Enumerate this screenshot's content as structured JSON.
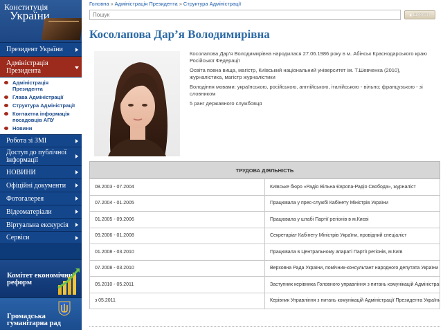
{
  "logo": {
    "line1": "Конституція",
    "line2": "України"
  },
  "nav": [
    {
      "label": "Президент України",
      "active": false
    },
    {
      "label": "Адміністрація Президента",
      "active": true
    },
    {
      "label": "Робота зі ЗМІ",
      "active": false
    },
    {
      "label": "Доступ до публічної інформації",
      "active": false
    },
    {
      "label": "НОВИНИ",
      "active": false
    },
    {
      "label": "Офіційні документи",
      "active": false
    },
    {
      "label": "Фотогалерея",
      "active": false
    },
    {
      "label": "Відеоматеріали",
      "active": false
    },
    {
      "label": "Віртуальна екскурсія",
      "active": false
    },
    {
      "label": "Сервіси",
      "active": false
    }
  ],
  "subnav": [
    "Адміністрація Президента",
    "Глава Адміністрації",
    "Структура Адміністрації",
    "Контактна інформація посадовців АПУ",
    "Новини"
  ],
  "banners": {
    "banner1": "Комітет економічних реформ",
    "banner2": "Громадська гуманітарна рад"
  },
  "breadcrumb": [
    "Головна",
    "Адміністрація Президента",
    "Структура Адміністрації"
  ],
  "search": {
    "placeholder": "Пошук",
    "button_label": "Шукати"
  },
  "page_title": "Косолапова Дар’я Володимирівна",
  "bio": [
    "Косолапова Дар’я Володимирівна народилася 27.06.1986 року в м. Абінськ Краснодарського краю Російської Федерації",
    "Освіта повна вища, магістр, Київський національний університет ім. Т.Шевченка (2010), журналістика, магістр журналістики",
    "Володіння мовами: українською, російською, англійською, італійською - вільно; французькою - зі словником",
    "5 ранг державного службовця"
  ],
  "career": {
    "header": "Трудова діяльність",
    "rows": [
      {
        "period": "08.2003 - 07.2004",
        "desc": "Київське бюро «Радіо Вільна Європа-Радіо Свобода», журналіст"
      },
      {
        "period": "07.2004 - 01.2005",
        "desc": "Працювала у прес-службі Кабінету Міністрів України"
      },
      {
        "period": "01.2005 - 09.2006",
        "desc": "Працювала у штабі Партії регіонів в м.Києві"
      },
      {
        "period": "09.2006 - 01.2008",
        "desc": "Секретаріат Кабінету Міністрів України, провідний спеціаліст"
      },
      {
        "period": "01.2008 - 03.2010",
        "desc": "Працювала в Центральному апараті Партії регіонів, м.Київ"
      },
      {
        "period": "07.2008 - 03.2010",
        "desc": "Верховна Рада України, помічник-консультант народного депутата України"
      },
      {
        "period": "05.2010 - 05.2011",
        "desc": "Заступник керівника Головного управління з питань комунікацій Адміністрації Президента України"
      },
      {
        "period": "з 05.2011",
        "desc": "Керівник Управління з питань комунікацій Адміністрації Президента України"
      }
    ]
  },
  "colors": {
    "sidebar": "#14468c",
    "active_nav": "#9c2b1d",
    "title": "#2c6aa6",
    "link": "#1a5aa8"
  }
}
